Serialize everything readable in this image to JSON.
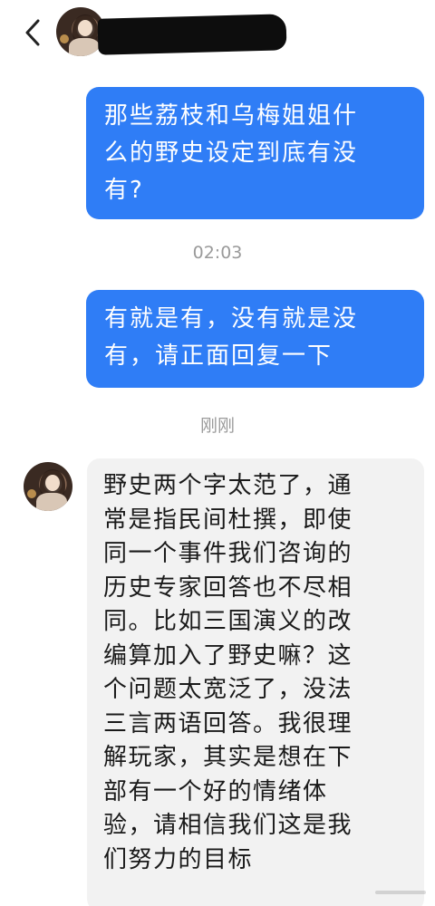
{
  "header": {
    "back_icon": "chevron-left-icon",
    "contact_avatar": "avatar",
    "contact_name_redacted": true
  },
  "messages": [
    {
      "direction": "outgoing",
      "text": "那些荔枝和乌梅姐姐什\n么的野史设定到底有没\n有?"
    },
    {
      "type": "timestamp",
      "text": "02:03"
    },
    {
      "direction": "outgoing",
      "text": "有就是有，没有就是没\n有，请正面回复一下"
    },
    {
      "type": "timestamp",
      "text": "刚刚"
    },
    {
      "direction": "incoming",
      "text": "野史两个字太范了，通\n常是指民间杜撰，即使\n同一个事件我们咨询的\n历史专家回答也不尽相\n同。比如三国演义的改\n编算加入了野史嘛？这\n个问题太宽泛了，没法\n三言两语回答。我很理\n解玩家，其实是想在下\n部有一个好的情绪体\n验，请相信我们这是我\n们努力的目标"
    }
  ],
  "colors": {
    "outgoing_bubble": "#2f7df6",
    "incoming_bubble": "#f2f2f2",
    "timestamp_text": "#9a9a9a"
  }
}
